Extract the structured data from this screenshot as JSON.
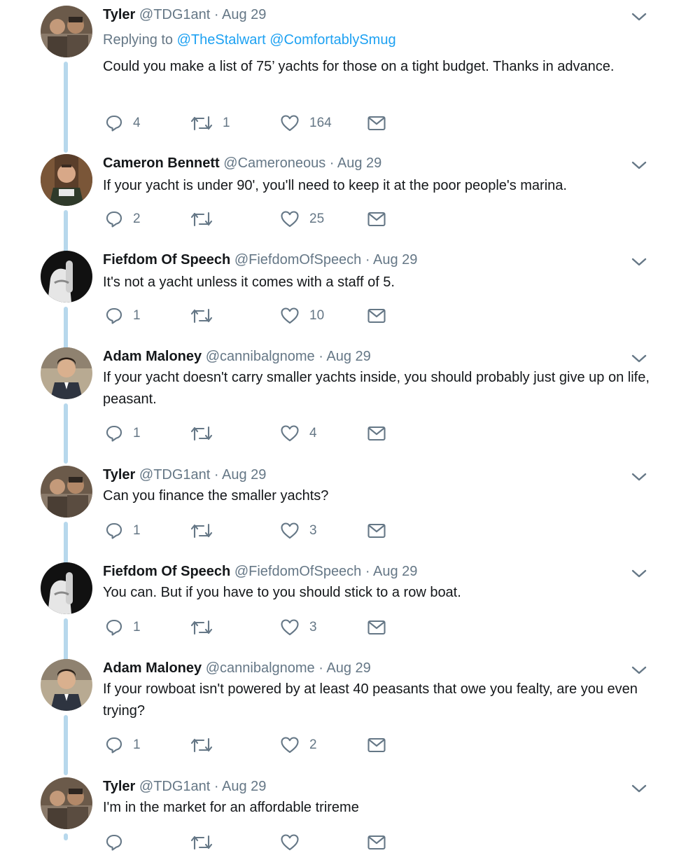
{
  "icons": {
    "reply": "reply-icon",
    "retweet": "retweet-icon",
    "like": "heart-icon",
    "dm": "envelope-icon",
    "more": "chevron-down-icon"
  },
  "colors": {
    "name": "#14171a",
    "meta": "#657786",
    "link": "#1da1f2",
    "connector": "#b7d8ec"
  },
  "tweets": [
    {
      "name": "Tyler",
      "handle": "@TDG1ant",
      "dot": "·",
      "time": "Aug 29",
      "replying_label": "Replying to",
      "replying": [
        "@TheStalwart",
        "@ComfortablySmug"
      ],
      "text": "Could you make a list of 75’ yachts for those on a tight budget. Thanks in advance.",
      "replies": "4",
      "retweets": "1",
      "likes": "164"
    },
    {
      "name": "Cameron Bennett",
      "handle": "@Cameroneous",
      "dot": "·",
      "time": "Aug 29",
      "text": "If your yacht is under 90', you'll need to keep it at the poor people's marina.",
      "replies": "2",
      "retweets": "",
      "likes": "25"
    },
    {
      "name": "Fiefdom Of Speech",
      "handle": "@FiefdomOfSpeech",
      "dot": "·",
      "time": "Aug 29",
      "text": "It's not a yacht unless it comes with a staff of 5.",
      "replies": "1",
      "retweets": "",
      "likes": "10"
    },
    {
      "name": "Adam Maloney",
      "handle": "@cannibalgnome",
      "dot": "·",
      "time": "Aug 29",
      "text": "If your yacht doesn't carry smaller yachts inside, you should probably just give up on life, peasant.",
      "replies": "1",
      "retweets": "",
      "likes": "4"
    },
    {
      "name": "Tyler",
      "handle": "@TDG1ant",
      "dot": "·",
      "time": "Aug 29",
      "text": "Can you finance the smaller yachts?",
      "replies": "1",
      "retweets": "",
      "likes": "3"
    },
    {
      "name": "Fiefdom Of Speech",
      "handle": "@FiefdomOfSpeech",
      "dot": "·",
      "time": "Aug 29",
      "text": "You can.  But if you have to you should stick to a row boat.",
      "replies": "1",
      "retweets": "",
      "likes": "3"
    },
    {
      "name": "Adam Maloney",
      "handle": "@cannibalgnome",
      "dot": "·",
      "time": "Aug 29",
      "text": "If your rowboat isn't powered by at least 40 peasants that owe you fealty, are you even trying?",
      "replies": "1",
      "retweets": "",
      "likes": "2"
    },
    {
      "name": "Tyler",
      "handle": "@TDG1ant",
      "dot": "·",
      "time": "Aug 29",
      "text": "I'm in the market for an affordable trireme",
      "replies": "",
      "retweets": "",
      "likes": ""
    }
  ]
}
